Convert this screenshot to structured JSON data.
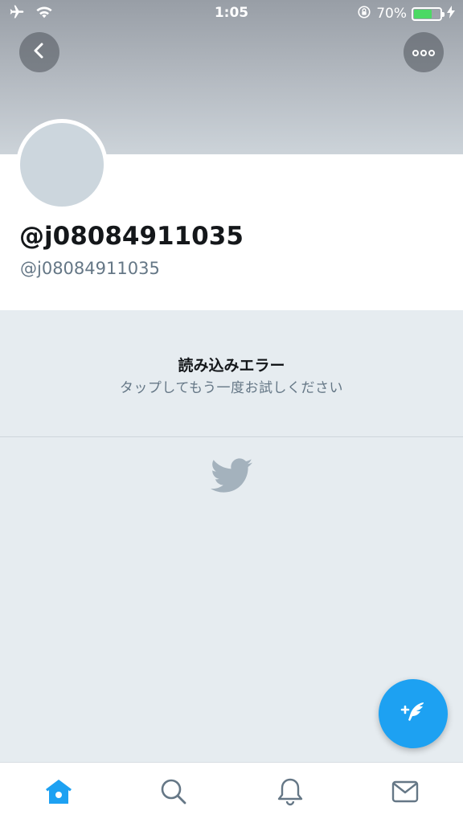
{
  "status_bar": {
    "time": "1:05",
    "battery_percent": "70%",
    "battery_level": 0.7,
    "icons": [
      "airplane-icon",
      "wifi-icon",
      "orientation-lock-icon",
      "battery-icon",
      "charging-icon"
    ]
  },
  "header": {
    "back_icon": "chevron-left-icon",
    "more_icon": "more-dots-icon"
  },
  "profile": {
    "display_name": "@j08084911035",
    "screen_name": "@j08084911035"
  },
  "error": {
    "title": "読み込みエラー",
    "subtitle": "タップしてもう一度お試しください"
  },
  "compose_icon": "compose-tweet-icon",
  "tabs": [
    {
      "name": "home",
      "icon": "home-icon",
      "active": true
    },
    {
      "name": "search",
      "icon": "search-icon",
      "active": false
    },
    {
      "name": "notifications",
      "icon": "bell-icon",
      "active": false
    },
    {
      "name": "messages",
      "icon": "envelope-icon",
      "active": false
    }
  ],
  "colors": {
    "accent": "#1da1f2",
    "background": "#e6ecf0",
    "secondary_text": "#657786",
    "battery_green": "#4cd964"
  }
}
